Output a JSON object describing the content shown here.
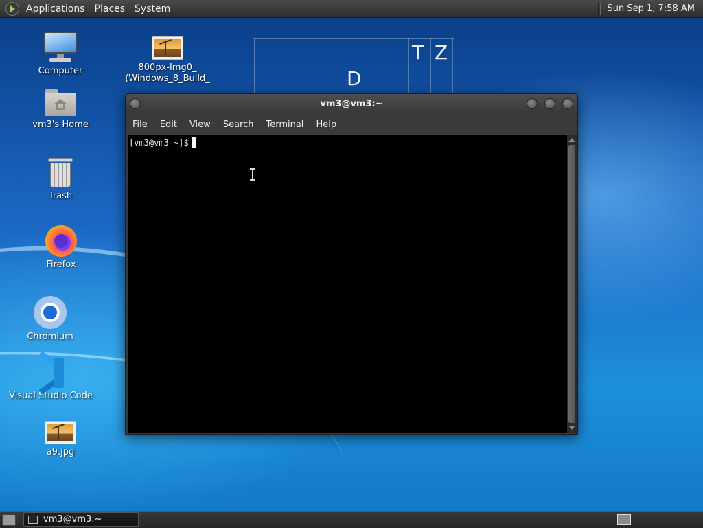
{
  "top_panel": {
    "menus": [
      "Applications",
      "Places",
      "System"
    ],
    "clock": "Sun Sep  1, 7:58 AM"
  },
  "desktop": {
    "icons": [
      {
        "label": "Computer",
        "icon": "computer-icon"
      },
      {
        "label": "vm3's Home",
        "icon": "home-folder-icon"
      },
      {
        "label": "Trash",
        "icon": "trash-icon"
      },
      {
        "label": "Firefox",
        "icon": "firefox-icon"
      },
      {
        "label": "Chromium",
        "icon": "chromium-icon"
      },
      {
        "label": "Visual Studio Code",
        "icon": "vscode-icon"
      },
      {
        "label": "a9.jpg",
        "icon": "image-file-icon"
      },
      {
        "label_lines": [
          "800px-Img0_",
          "(Windows_8_Build_"
        ],
        "icon": "image-file-icon"
      }
    ],
    "wallpaper_letters": [
      "T",
      "Z",
      "D"
    ]
  },
  "terminal": {
    "title": "vm3@vm3:~",
    "menu": [
      "File",
      "Edit",
      "View",
      "Search",
      "Terminal",
      "Help"
    ],
    "prompt": "[vm3@vm3 ~]$"
  },
  "bottom_panel": {
    "task_label": "vm3@vm3:~"
  },
  "colors": {
    "terminal_bg": "#000000",
    "panel_bg": "#2e2e2e",
    "wallpaper_blue": "#1b66c2"
  }
}
